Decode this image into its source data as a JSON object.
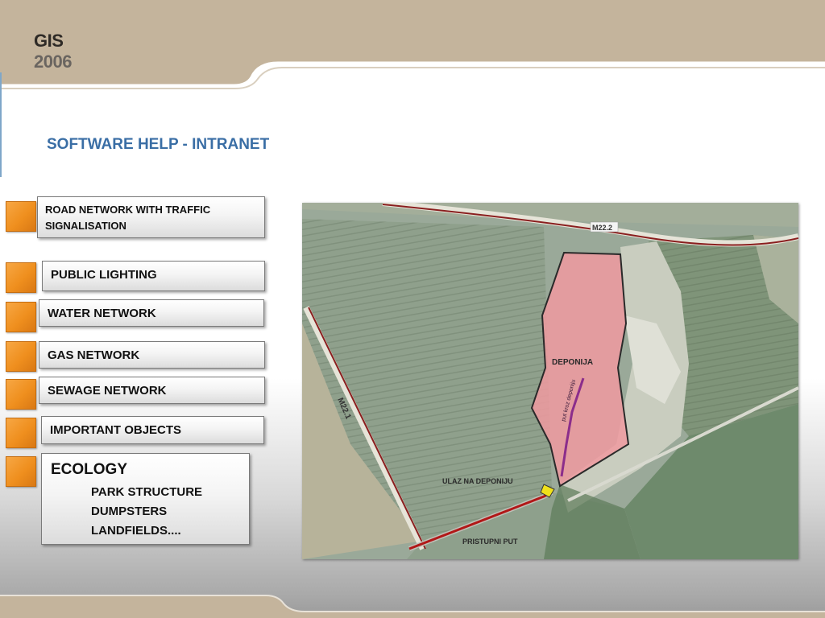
{
  "logo": {
    "line1": "GIS",
    "line2": "2006"
  },
  "page_title": "SOFTWARE HELP - INTRANET",
  "menu": {
    "road": "ROAD NETWORK WITH TRAFFIC SIGNALISATION",
    "lighting": "PUBLIC LIGHTING",
    "water": "WATER NETWORK",
    "gas": "GAS NETWORK",
    "sewage": "SEWAGE NETWORK",
    "objects": "IMPORTANT OBJECTS",
    "ecology": {
      "title": "ECOLOGY",
      "items": [
        "PARK STRUCTURE",
        "DUMPSTERS",
        "LANDFIELDS...."
      ]
    }
  },
  "map": {
    "labels": {
      "road_top": "M22.2",
      "road_left": "M22.1",
      "landfill": "DEPONIJA",
      "entrance": "ULAZ NA DEPONIJU",
      "access_road": "PRISTUPNI PUT",
      "internal_path": "put kroz deponiju"
    }
  },
  "colors": {
    "accent_orange": "#ef8f1e",
    "title_blue": "#3a6ea5",
    "header_tan": "#c4b49c",
    "landfill_pink": "#f09aa0",
    "road_red": "#9b1b1b"
  }
}
